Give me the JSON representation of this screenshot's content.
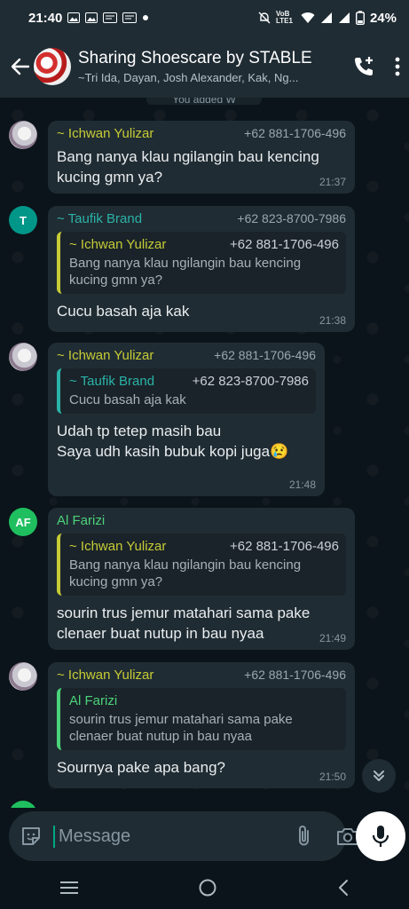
{
  "status": {
    "time": "21:40",
    "left_icons": [
      "gallery-icon",
      "gallery-icon",
      "message-icon",
      "message-icon",
      "dot-icon"
    ],
    "right_icons": [
      "mute-icon",
      "volte-icon",
      "wifi-icon",
      "signal-icon",
      "signal-icon",
      "battery-icon"
    ],
    "volte": "VoB LTE1",
    "battery": "24%"
  },
  "header": {
    "title": "Sharing Shoescare by STABLE",
    "participants": "~Tri Ida, Dayan, Josh Alexander, Kak, Ng..."
  },
  "system_note": "You added W",
  "messages": [
    {
      "sender": "~ Ichwan Yulizar",
      "phone": "+62 881-1706-496",
      "text": "Bang nanya klau ngilangin bau kencing kucing gmn ya?",
      "time": "21:37"
    },
    {
      "avatar_initial": "T",
      "sender": "~ Taufik Brand",
      "phone": "+62 823-8700-7986",
      "quote": {
        "sender": "~ Ichwan Yulizar",
        "phone": "+62 881-1706-496",
        "text": "Bang nanya klau ngilangin bau kencing kucing gmn ya?"
      },
      "text": "Cucu basah aja kak",
      "time": "21:38"
    },
    {
      "sender": "~ Ichwan Yulizar",
      "phone": "+62 881-1706-496",
      "quote": {
        "sender": "~ Taufik Brand",
        "phone": "+62 823-8700-7986",
        "text": "Cucu basah aja kak"
      },
      "text_line1": "Udah tp tetep masih bau",
      "text_line2": "Saya udh kasih bubuk kopi juga😢",
      "time": "21:48"
    },
    {
      "avatar_initial": "AF",
      "sender": "Al Farizi",
      "quote": {
        "sender": "~ Ichwan Yulizar",
        "phone": "+62 881-1706-496",
        "text": "Bang nanya klau ngilangin bau kencing kucing gmn ya?"
      },
      "text": "sourin trus jemur matahari sama pake clenaer buat nutup in bau nyaa",
      "time": "21:49"
    },
    {
      "sender": "~ Ichwan Yulizar",
      "phone": "+62 881-1706-496",
      "quote": {
        "sender": "Al Farizi",
        "text": "sourin trus jemur matahari sama pake clenaer buat nutup in bau nyaa"
      },
      "text": "Sournya pake apa bang?",
      "time": "21:50"
    }
  ],
  "composer": {
    "placeholder": "Message"
  },
  "colors": {
    "background": "#0b141a",
    "bubble": "#202c33",
    "header": "#1f2c34",
    "accent": "#00a884",
    "name_ichwan": "#c6cc36",
    "name_taufik": "#2ab3a8",
    "name_alfarizi": "#4bd37a"
  }
}
